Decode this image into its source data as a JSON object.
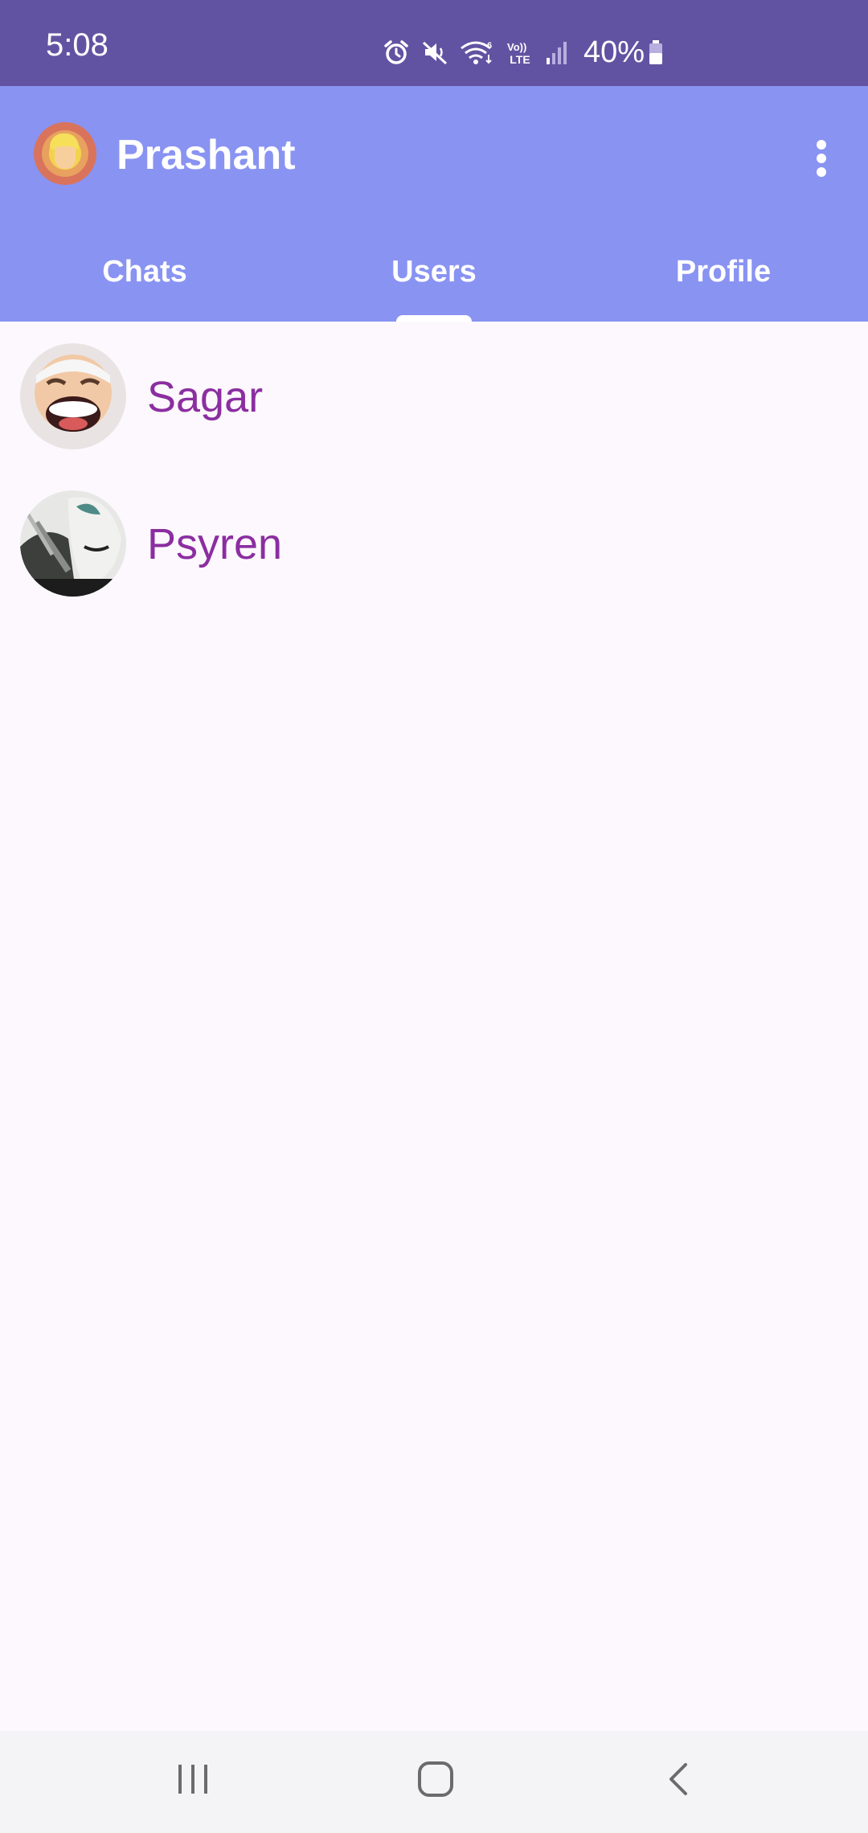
{
  "status_bar": {
    "time": "5:08",
    "battery_percent": "40%",
    "network_label": "LTE",
    "icons": [
      "alarm-icon",
      "mute-icon",
      "wifi-icon",
      "volte-icon",
      "signal-icon",
      "battery-icon"
    ]
  },
  "app_bar": {
    "title": "Prashant",
    "menu_icon": "more-vert-icon",
    "background_color": "#8993f2"
  },
  "tabs": [
    {
      "label": "Chats",
      "selected": false
    },
    {
      "label": "Users",
      "selected": true
    },
    {
      "label": "Profile",
      "selected": false
    }
  ],
  "users": [
    {
      "name": "Sagar"
    },
    {
      "name": "Psyren"
    }
  ],
  "colors": {
    "status_bar": "#6253a2",
    "accent": "#8993f2",
    "user_name": "#8b2ea0",
    "background": "#fcf8fd"
  },
  "nav_bar": {
    "buttons": [
      "recents-icon",
      "home-icon",
      "back-icon"
    ]
  }
}
